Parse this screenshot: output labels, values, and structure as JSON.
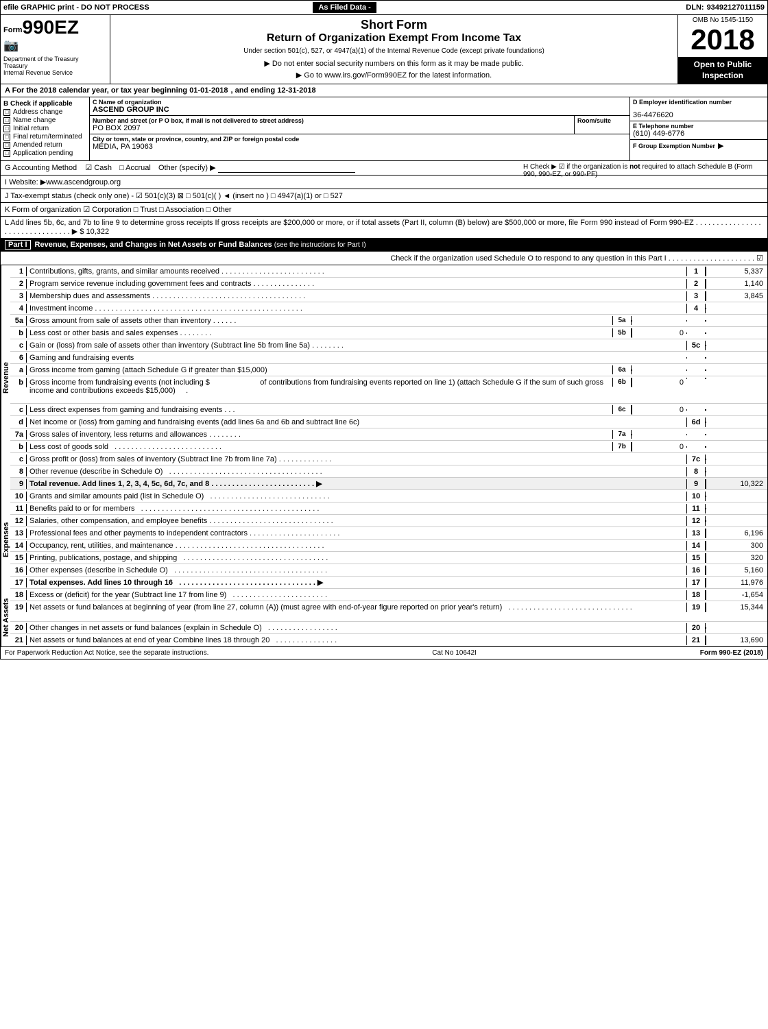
{
  "topBar": {
    "efileText": "efile GRAPHIC print - DO NOT PROCESS",
    "asFiledText": "As Filed Data -",
    "dlnLabel": "DLN:",
    "dlnNumber": "93492127011159"
  },
  "formHeader": {
    "formPrefix": "Form",
    "formNumber": "990EZ",
    "shortForm": "Short Form",
    "returnTitle": "Return of Organization Exempt From Income Tax",
    "subtitle": "Under section 501(c), 527, or 4947(a)(1) of the Internal Revenue Code (except private foundations)",
    "ombLabel": "OMB No 1545-1150",
    "year": "2018",
    "openToPublic": "Open to Public Inspection",
    "deptLabel": "Department of the Treasury",
    "treasuryLabel": "Treasury",
    "irsLabel": "Internal Revenue Service"
  },
  "notices": {
    "ssn": "▶ Do not enter social security numbers on this form as it may be made public.",
    "url": "▶ Go to www.irs.gov/Form990EZ for the latest information."
  },
  "taxYear": {
    "rowA": "A  For the 2018 calendar year, or tax year beginning 01-01-2018",
    "andEnding": ", and ending 12-31-2018"
  },
  "checkItems": {
    "label": "B  Check if applicable",
    "items": [
      "Address change",
      "Name change",
      "Initial return",
      "Final return/terminated",
      "Amended return",
      "Application pending"
    ]
  },
  "orgInfo": {
    "nameLabel": "C Name of organization",
    "nameValue": "ASCEND GROUP INC",
    "addressLabel": "Number and street (or P O box, if mail is not delivered to street address)",
    "addressValue": "PO BOX 2097",
    "roomLabel": "Room/suite",
    "roomValue": "",
    "cityLabel": "City or town, state or province, country, and ZIP or foreign postal code",
    "cityValue": "MEDIA, PA  19063"
  },
  "einInfo": {
    "label": "D Employer identification number",
    "value": "36-4476620",
    "phoneLabel": "E Telephone number",
    "phoneValue": "(610) 449-6776",
    "groupLabel": "F Group Exemption Number",
    "groupArrow": "▶"
  },
  "accounting": {
    "rowG": "G  Accounting Method",
    "cashLabel": "☑ Cash",
    "accrualLabel": "□ Accrual",
    "otherLabel": "Other (specify) ▶",
    "rowH": "H  Check ▶ ☑ if the organization is not required to attach Schedule B (Form 990, 990-EZ, or 990-PF)"
  },
  "website": {
    "rowI": "I  Website: ▶www.ascendgroup.org"
  },
  "taxStatus": {
    "rowJ": "J  Tax-exempt status (check only one) - ☑ 501(c)(3) ⊠ □ 501(c)(  ) ◄ (insert no ) □ 4947(a)(1) or □ 527"
  },
  "formOrg": {
    "rowK": "K  Form of organization    ☑ Corporation  □ Trust  □ Association  □ Other"
  },
  "lineL": {
    "text": "L  Add lines 5b, 6c, and 7b to line 9 to determine gross receipts  If gross receipts are $200,000 or more, or if total assets (Part II, column (B) below) are $500,000 or more, file Form 990 instead of Form 990-EZ . . . . . . . . . . . . . . . . . . . . . . . . . . . . . . . . ▶ $ 10,322"
  },
  "partI": {
    "label": "Part I",
    "title": "Revenue, Expenses, and Changes in Net Assets or Fund Balances",
    "titleNote": "(see the instructions for Part I)",
    "checkLine": "Check if the organization used Schedule O to respond to any question in this Part I . . . . . . . . . . . . . . . . . . . . . ☑"
  },
  "revenueRows": [
    {
      "num": "1",
      "desc": "Contributions, gifts, grants, and similar amounts received . . . . . . . . . . . . . . . . . . . . . . . .",
      "lineNum": "1",
      "value": "5,337"
    },
    {
      "num": "2",
      "desc": "Program service revenue including government fees and contracts . . . . . . . . . . . . . . .",
      "lineNum": "2",
      "value": "1,140"
    },
    {
      "num": "3",
      "desc": "Membership dues and assessments . . . . . . . . . . . . . . . . . . . . . . . . . . . . . . . . . . . . .",
      "lineNum": "3",
      "value": "3,845"
    },
    {
      "num": "4",
      "desc": "Investment income . . . . . . . . . . . . . . . . . . . . . . . . . . . . . . . . . . . . . . . . . . . . . . . . . .",
      "lineNum": "4",
      "value": ""
    },
    {
      "num": "5a",
      "desc": "Gross amount from sale of assets other than inventory . . . . . .",
      "subNum": "5a",
      "subValue": "",
      "lineNum": "",
      "value": ""
    },
    {
      "num": "5b",
      "desc": "Less  cost or other basis and sales expenses . . . . . . . .",
      "subNum": "5b",
      "subValue": "0",
      "lineNum": "",
      "value": ""
    },
    {
      "num": "5c",
      "desc": "Gain or (loss) from sale of assets other than inventory (Subtract line 5b from line 5a) . . . . . . . .",
      "lineNum": "5c",
      "value": ""
    }
  ],
  "gamingRows": [
    {
      "letter": "a",
      "desc": "Gross income from gaming (attach Schedule G if greater than $15,000)",
      "subNum": "6a",
      "subValue": ""
    },
    {
      "letter": "b1",
      "desc": "Gross income from fundraising events (not including $                            of contributions from fundraising events reported on line 1) (attach Schedule G if the sum of such gross income and contributions exceeds $15,000) . .",
      "subNum": "6b",
      "subValue": "0"
    },
    {
      "letter": "c",
      "desc": "Less  direct expenses from gaming and fundraising events . . .",
      "subNum": "6c",
      "subValue": "0"
    },
    {
      "letter": "d",
      "desc": "Net income or (loss) from gaming and fundraising events (add lines 6a and 6b and subtract line 6c)",
      "lineNum": "6d",
      "value": ""
    }
  ],
  "inventoryRows": [
    {
      "num": "7a",
      "desc": "Gross sales of inventory, less returns and allowances . . . . . . . .",
      "subNum": "7a",
      "subValue": ""
    },
    {
      "num": "7b",
      "desc": "Less  cost of goods sold . . . . . . . . . . . . . . . . . . . . . . . . . .",
      "subNum": "7b",
      "subValue": "0"
    },
    {
      "num": "7c",
      "desc": "Gross profit or (loss) from sales of inventory (Subtract line 7b from line 7a) . . . . . . . . . . . . .",
      "lineNum": "7c",
      "value": ""
    }
  ],
  "otherRevenueRows": [
    {
      "num": "8",
      "desc": "Other revenue (describe in Schedule O)  . . . . . . . . . . . . . . . . . . . . . . . . . . . . . . . . . . . . .",
      "lineNum": "8",
      "value": ""
    },
    {
      "num": "9",
      "desc": "Total revenue. Add lines 1, 2, 3, 4, 5c, 6d, 7c, and 8 . . . . . . . . . . . . . . . . . . . . . . . . . ▶",
      "lineNum": "9",
      "value": "10,322",
      "bold": true,
      "total": true
    }
  ],
  "expenseRows": [
    {
      "num": "10",
      "desc": "Grants and similar amounts paid (list in Schedule O)   . . . . . . . . . . . . . . . . . . . . . . . . . . . . .",
      "lineNum": "10",
      "value": ""
    },
    {
      "num": "11",
      "desc": "Benefits paid to or for members   . . . . . . . . . . . . . . . . . . . . . . . . . . . . . . . . . . . . . . . . . . .",
      "lineNum": "11",
      "value": ""
    },
    {
      "num": "12",
      "desc": "Salaries, other compensation, and employee benefits . . . . . . . . . . . . . . . . . . . . . . . . . . . . . .",
      "lineNum": "12",
      "value": ""
    },
    {
      "num": "13",
      "desc": "Professional fees and other payments to independent contractors . . . . . . . . . . . . . . . . . . . . . .",
      "lineNum": "13",
      "value": "6,196"
    },
    {
      "num": "14",
      "desc": "Occupancy, rent, utilities, and maintenance . . . . . . . . . . . . . . . . . . . . . . . . . . . . . . . . . . . .",
      "lineNum": "14",
      "value": "300"
    },
    {
      "num": "15",
      "desc": "Printing, publications, postage, and shipping  . . . . . . . . . . . . . . . . . . . . . . . . . . . . . . . . . . .",
      "lineNum": "15",
      "value": "320"
    },
    {
      "num": "16",
      "desc": "Other expenses (describe in Schedule O)  . . . . . . . . . . . . . . . . . . . . . . . . . . . . . . . . . . . . .",
      "lineNum": "16",
      "value": "5,160"
    },
    {
      "num": "17",
      "desc": "Total expenses. Add lines 10 through 16   . . . . . . . . . . . . . . . . . . . . . . . . . . . . . . . . . ▶",
      "lineNum": "17",
      "value": "11,976",
      "bold": true,
      "total": true
    }
  ],
  "netAssetRows": [
    {
      "num": "18",
      "desc": "Excess or (deficit) for the year (Subtract line 17 from line 9)   . . . . . . . . . . . . . . . . . . . . . . .",
      "lineNum": "18",
      "value": "-1,654"
    },
    {
      "num": "19",
      "desc": "Net assets or fund balances at beginning of year (from line 27, column (A)) (must agree with end-of-year figure reported on prior year's return)  . . . . . . . . . . . . . . . . . . . . . . . . . . . . . .",
      "lineNum": "19",
      "value": "15,344"
    },
    {
      "num": "20",
      "desc": "Other changes in net assets or fund balances (explain in Schedule O)   . . . . . . . . . . . . . . . . .",
      "lineNum": "20",
      "value": ""
    },
    {
      "num": "21",
      "desc": "Net assets or fund balances at end of year  Combine lines 18 through 20  . . . . . . . . . . . . . . .",
      "lineNum": "21",
      "value": "13,690"
    }
  ],
  "footer": {
    "paperwork": "For Paperwork Reduction Act Notice, see the separate instructions.",
    "catNo": "Cat No 10642I",
    "formLabel": "Form 990-EZ (2018)"
  }
}
